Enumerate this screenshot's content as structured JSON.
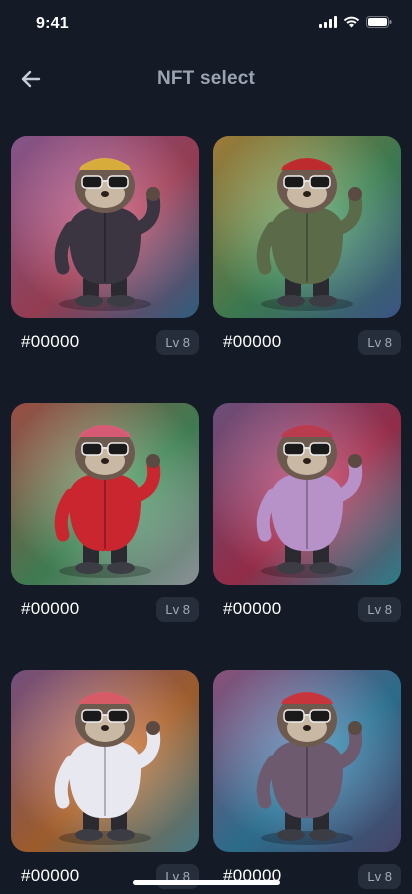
{
  "status_bar": {
    "time": "9:41",
    "icons": [
      "signal-icon",
      "wifi-icon",
      "battery-icon"
    ]
  },
  "header": {
    "title": "NFT select",
    "back_icon": "arrow-left-icon"
  },
  "nfts": [
    {
      "id": "#00000",
      "level": "Lv 8",
      "bg": [
        "#b072b8",
        "#c4506c",
        "#3f7ca8"
      ],
      "body": "#3a3540",
      "accent": "#e2b53a"
    },
    {
      "id": "#00000",
      "level": "Lv 8",
      "bg": [
        "#d3a24a",
        "#4fa06a",
        "#4e6fb0"
      ],
      "body": "#5b6b4a",
      "accent": "#c5262b"
    },
    {
      "id": "#00000",
      "level": "Lv 8",
      "bg": [
        "#d0655a",
        "#53a36b",
        "#b8c0c8"
      ],
      "body": "#c9262f",
      "accent": "#e25a7a"
    },
    {
      "id": "#00000",
      "level": "Lv 8",
      "bg": [
        "#8e6aa3",
        "#c23a5f",
        "#39a8b8"
      ],
      "body": "#b692c8",
      "accent": "#c0384e"
    },
    {
      "id": "#00000",
      "level": "Lv 8",
      "bg": [
        "#9a68a8",
        "#d07a3a",
        "#5aa0b0"
      ],
      "body": "#e8e8f0",
      "accent": "#e25a6a"
    },
    {
      "id": "#00000",
      "level": "Lv 8",
      "bg": [
        "#b86aa0",
        "#3a8fb8",
        "#5e5a8a"
      ],
      "body": "#6e5a6e",
      "accent": "#d0303a"
    }
  ],
  "colors": {
    "background": "#141a26",
    "badge_bg": "#272e3b",
    "title": "#9aa3b2"
  }
}
